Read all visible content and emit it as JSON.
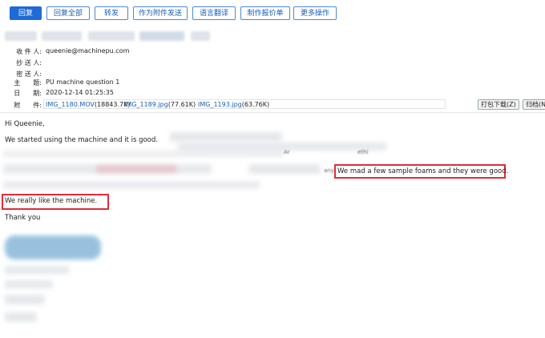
{
  "toolbar": {
    "reply": "回复",
    "reply_all": "回复全部",
    "forward": "转发",
    "forward_as_attachment": "作为附件发送",
    "translate": "语言翻译",
    "make_quote": "制作报价单",
    "more_actions": "更多操作"
  },
  "header": {
    "to_label": "收 件 人:",
    "to_value": "queenie@machinepu.com",
    "cc_label": "抄 送 人:",
    "bcc_label": "密 送 人:",
    "subject_label": "主　　题:",
    "subject_value": "PU machine question 1",
    "date_label": "日　　期:",
    "date_value": "2020-12-14 01:25:35",
    "attach_label": "附　　件:",
    "attachments": [
      {
        "name": "IMG_1180.MOV",
        "size": "(18843.7K)"
      },
      {
        "name": "IMG_1189.jpg",
        "size": "(77.61K)"
      },
      {
        "name": "IMG_1193.jpg",
        "size": "(63.76K)"
      }
    ],
    "download_all": "打包下载(Z)",
    "archive": "归档(N)"
  },
  "body": {
    "greeting": "Hi Queenie,",
    "line1": "We started using the machine and it is good.",
    "highlight1": "We mad a few sample foams and they were good.",
    "highlight2": "We really like the machine.",
    "closing": "Thank you",
    "fragment_any": "any",
    "fragment_ar": "Ar",
    "fragment_ethi": "ethi"
  }
}
